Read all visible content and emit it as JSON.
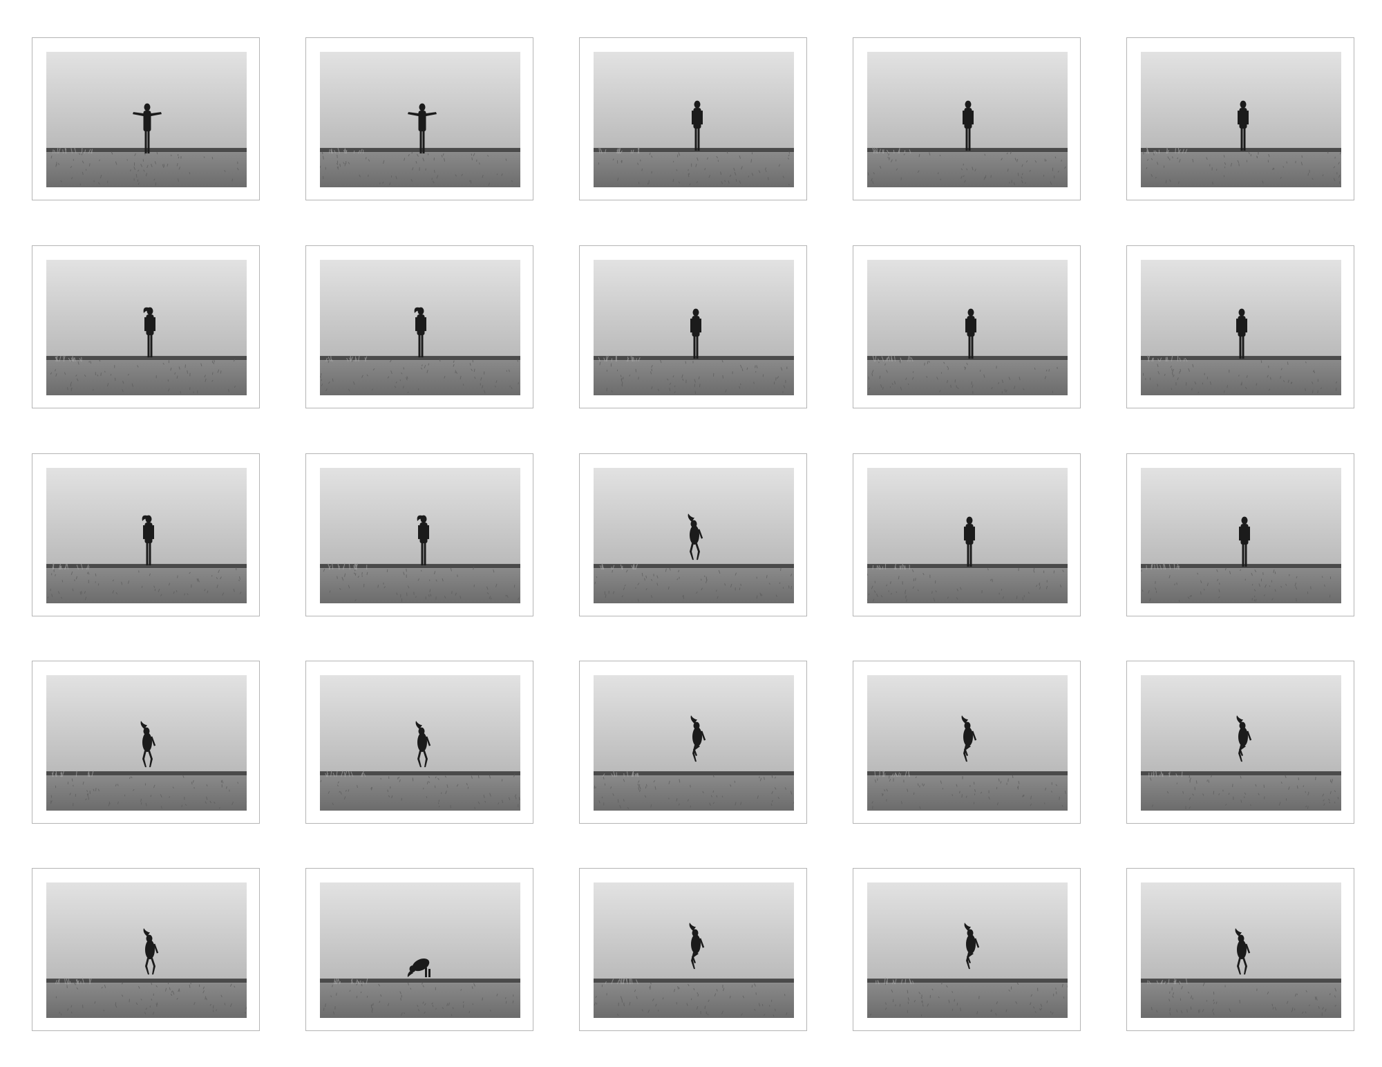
{
  "image_type": "photographic contact sheet — grid of black-and-white prints",
  "colors": {
    "page_background": "#ffffff",
    "print_border": "#b4b4b4",
    "sky_top": "#e2e2e2",
    "sky_horizon": "#b9b9b9",
    "treeline": "#4a4a4a",
    "grass": "#6c6c6c",
    "figure": "#1b1b1b"
  },
  "grid": {
    "rows": 5,
    "columns": 5
  },
  "frames": [
    {
      "pose": "arms-out"
    },
    {
      "pose": "arms-out"
    },
    {
      "pose": "arms-down"
    },
    {
      "pose": "arms-down"
    },
    {
      "pose": "arms-down"
    },
    {
      "pose": "hair-flip"
    },
    {
      "pose": "hair-flip"
    },
    {
      "pose": "arms-down"
    },
    {
      "pose": "arms-down"
    },
    {
      "pose": "arms-down"
    },
    {
      "pose": "hair-flip"
    },
    {
      "pose": "hair-flip"
    },
    {
      "pose": "crouch-jump"
    },
    {
      "pose": "arms-down"
    },
    {
      "pose": "arms-down"
    },
    {
      "pose": "crouch-jump"
    },
    {
      "pose": "crouch-jump"
    },
    {
      "pose": "knees-up"
    },
    {
      "pose": "knees-up"
    },
    {
      "pose": "knees-up"
    },
    {
      "pose": "crouch-jump"
    },
    {
      "pose": "leaning-crouch"
    },
    {
      "pose": "knees-up"
    },
    {
      "pose": "knees-up"
    },
    {
      "pose": "crouch-jump"
    }
  ]
}
